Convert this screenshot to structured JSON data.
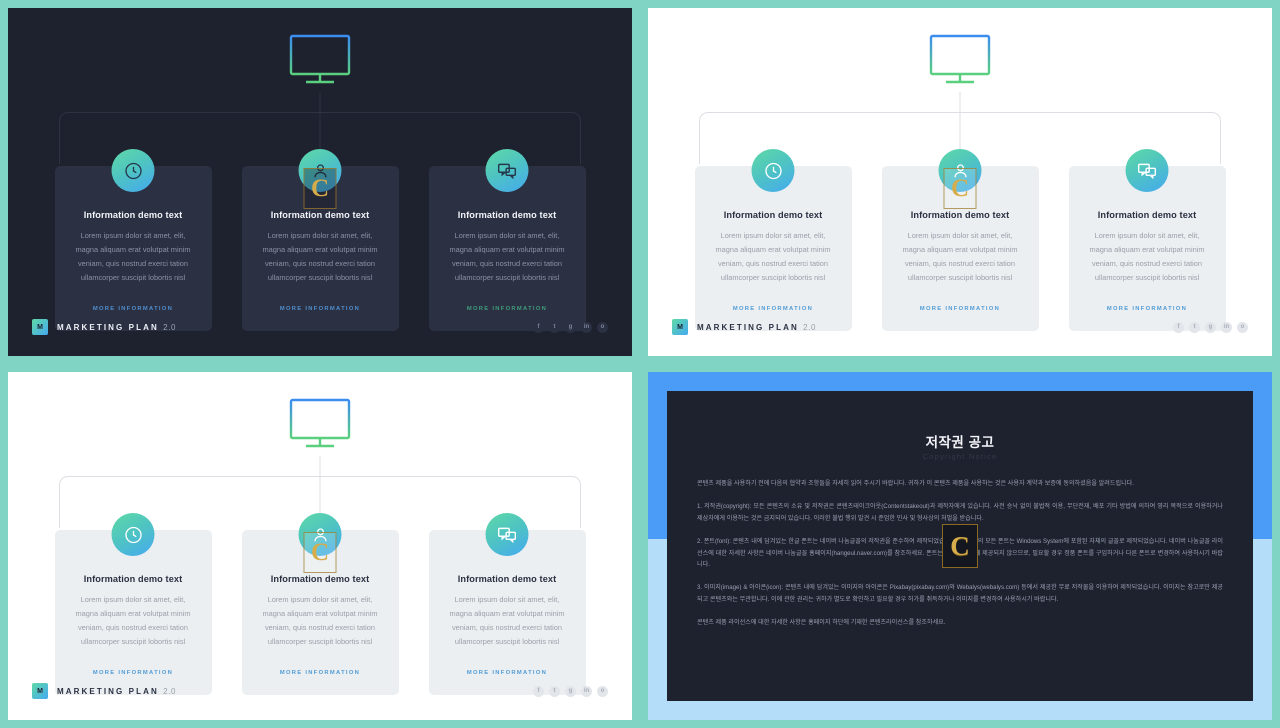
{
  "theme": {
    "frame_color": "#7fd4c4",
    "dark_bg": "#1e212e",
    "light_bg": "#ffffff",
    "card_dark": "#2b3042",
    "card_light": "#eceff1",
    "accent_gradient_start": "#5fd9a6",
    "accent_gradient_end": "#45a9f0",
    "link_blue": "#4f9bd6",
    "link_green": "#3f9d7d",
    "copyright_band_top": "#4a9cf6",
    "copyright_band_bottom": "#b3ddf8",
    "watermark_gold": "#d7ac4a"
  },
  "slide": {
    "hero_icon": "monitor-icon",
    "cards": [
      {
        "icon": "clock-icon",
        "title": "Information demo text",
        "body": "Lorem ipsum dolor sit amet, elit, magna aliquam erat volutpat minim veniam, quis nostrud exerci tation ullamcorper suscipit lobortis nisl",
        "link": "MORE INFORMATION"
      },
      {
        "icon": "user-icon",
        "title": "Information demo text",
        "body": "Lorem ipsum dolor sit amet, elit, magna aliquam erat volutpat minim veniam, quis nostrud exerci tation ullamcorper suscipit lobortis nisl",
        "link": "MORE INFORMATION"
      },
      {
        "icon": "chat-icon",
        "title": "Information demo text",
        "body": "Lorem ipsum dolor sit amet, elit, magna aliquam erat volutpat minim veniam, quis nostrud exerci tation ullamcorper suscipit lobortis nisl",
        "link": "MORE INFORMATION"
      }
    ],
    "footer": {
      "logo_letter": "M",
      "brand": "MARKETING PLAN",
      "version": "2.0",
      "socials": [
        {
          "name": "facebook-icon",
          "glyph": "f"
        },
        {
          "name": "twitter-icon",
          "glyph": "t"
        },
        {
          "name": "googleplus-icon",
          "glyph": "g"
        },
        {
          "name": "linkedin-icon",
          "glyph": "in"
        },
        {
          "name": "instagram-icon",
          "glyph": "o"
        }
      ]
    },
    "watermark_letter": "C"
  },
  "copyright": {
    "title": "저작권 공고",
    "subtitle": "Copyright Notice",
    "watermark_letter": "C",
    "paragraphs": [
      "콘텐츠 제품을 사용하기 전에 다음의 협약과 조항들을 자세히 읽어 주시기 바랍니다. 귀하가 이 콘텐츠 제품을 사용하는 것은 사용자 계약과 보증에 동의하셨음을 알려드립니다.",
      "1. 저작권(copyright): 모든 콘텐츠의 소유 및 저작권은 콘텐츠테이크아웃(Contentstakeout)과 제작자에게 있습니다. 사전 승낙 없이 불법적 이용, 무단전재, 배포 기타 방법에 의하여 영리 목적으로 이용하거나 제삼자에게 이용하는 것은 금지되어 있습니다. 이러한 불법 행위 발견 시 준엄한 민사 및 형사상의 처벌을 받습니다.",
      "2. 폰트(font): 콘텐츠 내에 담겨있는 한글 폰트는 네이버 나눔글꼴의 저작권을 준수하여 제작되었습니다. 한글 외의 모든 폰트는 Windows System에 포함된 자체의 글꼴로 제작되었습니다. 네이버 나눔글꼴 라이선스에 대한 자세한 사항은 네이버 나눔글꼴 홈페이지(hangeul.naver.com)를 참조하세요. 폰트는 콘텐츠와 함께 제공되지 않으므로, 필요할 경우 정품 폰트를 구입하거나 다른 폰트로 변경하여 사용하시기 바랍니다.",
      "3. 이미지(image) & 아이콘(icon): 콘텐츠 내에 담겨있는 이미지와 아이콘은 Pixabay(pixabay.com)와 Webalys(webalys.com) 등에서 제공한 무료 저작물을 이용하여 제작되었습니다. 이미지는 참고로만 제공되고 콘텐츠와는 무관합니다. 이에 관한 권리는 귀하가 별도로 확인하고 필요할 경우 허가를 취득하거나 이미지를 변경하여 사용하시기 바랍니다.",
      "콘텐츠 제품 라이선스에 대한 자세한 사항은 홈페이지 하단에 기재한 콘텐츠라이선스를 참조하세요."
    ]
  }
}
